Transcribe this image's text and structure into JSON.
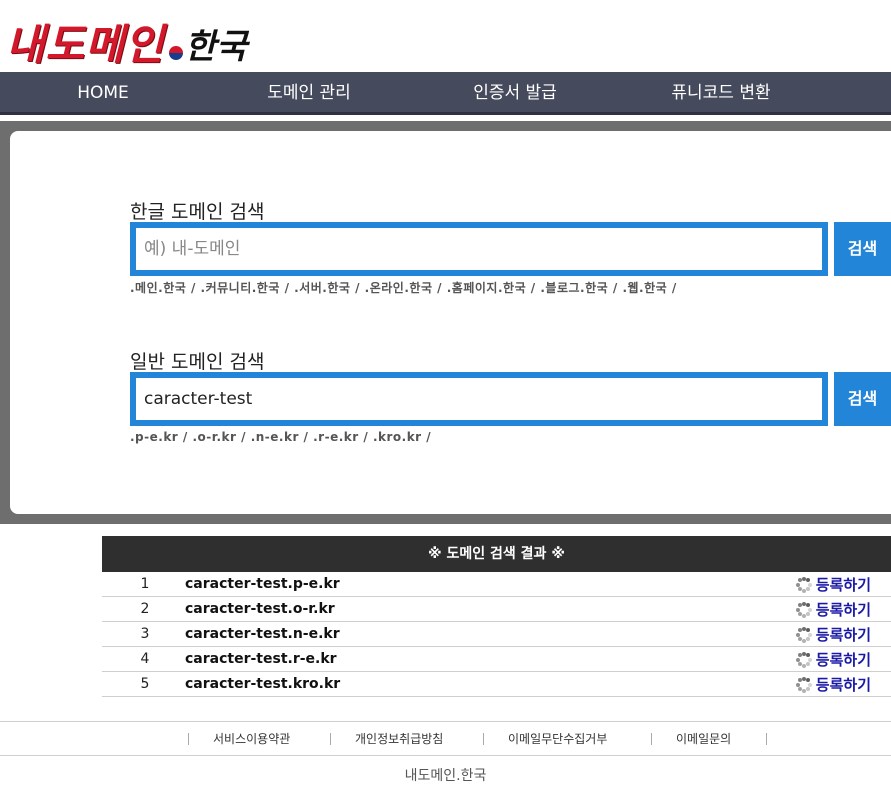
{
  "logo": {
    "main": "내도메인",
    "tld": "한국"
  },
  "nav": {
    "items": [
      "HOME",
      "도메인 관리",
      "인증서 발급",
      "퓨니코드 변환"
    ]
  },
  "korean_search": {
    "title": "한글 도메인 검색",
    "placeholder": "예) 내-도메인",
    "value": "",
    "button": "검색",
    "tlds": [
      ".메인.한국",
      ".커뮤니티.한국",
      ".서버.한국",
      ".온라인.한국",
      ".홈페이지.한국",
      ".블로그.한국",
      ".웹.한국"
    ]
  },
  "general_search": {
    "title": "일반 도메인 검색",
    "value": "caracter-test",
    "button": "검색",
    "tlds": [
      ".p-e.kr",
      ".o-r.kr",
      ".n-e.kr",
      ".r-e.kr",
      ".kro.kr"
    ]
  },
  "results": {
    "header": "※ 도메인 검색 결과 ※",
    "register_label": "등록하기",
    "rows": [
      {
        "num": "1",
        "domain": "caracter-test.p-e.kr"
      },
      {
        "num": "2",
        "domain": "caracter-test.o-r.kr"
      },
      {
        "num": "3",
        "domain": "caracter-test.n-e.kr"
      },
      {
        "num": "4",
        "domain": "caracter-test.r-e.kr"
      },
      {
        "num": "5",
        "domain": "caracter-test.kro.kr"
      }
    ]
  },
  "footer": {
    "links": [
      "서비스이용약관",
      "개인정보취급방침",
      "이메일무단수집거부",
      "이메일문의"
    ],
    "copyright": "내도메인.한국"
  },
  "colors": {
    "nav_bg": "#454a5c",
    "accent": "#2385d8",
    "logo_red": "#d2182a",
    "results_head": "#2f2f2f",
    "register_link": "#1a1aa6"
  }
}
